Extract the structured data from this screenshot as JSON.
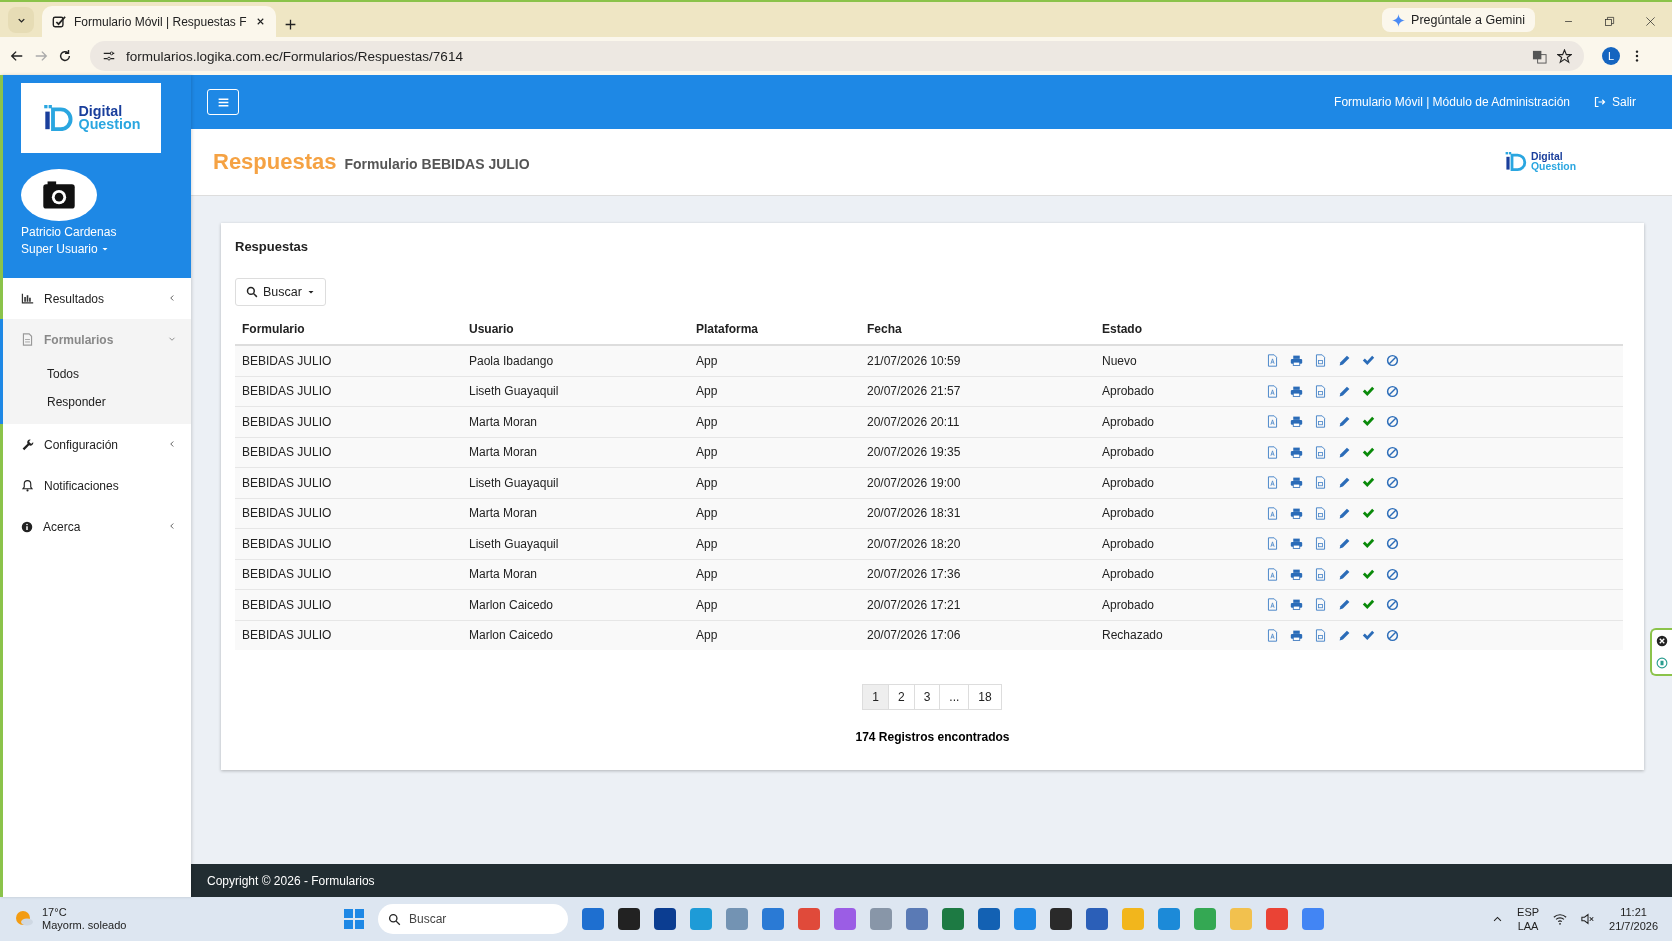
{
  "browser": {
    "tab_title": "Formulario Móvil | Respuestas F",
    "url": "formularios.logika.com.ec/Formularios/Respuestas/7614",
    "gemini": "Pregúntale a Gemini",
    "profile": "L"
  },
  "header": {
    "title": "Formulario Móvil | Módulo de Administración",
    "logout": "Salir"
  },
  "sidebar": {
    "logo": {
      "line1": "Digital",
      "line2": "Question"
    },
    "user": "Patricio Cardenas",
    "role": "Super Usuario",
    "items": [
      {
        "label": "Resultados",
        "kind": "group",
        "expanded": false,
        "selected": false
      },
      {
        "label": "Formularios",
        "kind": "group",
        "expanded": true,
        "selected": true,
        "children": [
          {
            "label": "Todos"
          },
          {
            "label": "Responder"
          }
        ]
      },
      {
        "label": "Configuración",
        "kind": "group",
        "expanded": false,
        "selected": false
      },
      {
        "label": "Notificaciones",
        "kind": "link",
        "selected": false
      },
      {
        "label": "Acerca",
        "kind": "group",
        "expanded": false,
        "selected": false
      }
    ]
  },
  "page": {
    "title": "Respuestas",
    "subtitle": "Formulario BEBIDAS JULIO",
    "logo": {
      "line1": "Digital",
      "line2": "Question"
    }
  },
  "card": {
    "title": "Respuestas",
    "search_button": "Buscar",
    "table": {
      "columns": [
        "Formulario",
        "Usuario",
        "Plataforma",
        "Fecha",
        "Estado"
      ],
      "rows": [
        {
          "cells": [
            "BEBIDAS JULIO",
            "Paola Ibadango",
            "App",
            "21/07/2026 10:59",
            "Nuevo"
          ],
          "approved": false
        },
        {
          "cells": [
            "BEBIDAS JULIO",
            "Liseth Guayaquil",
            "App",
            "20/07/2026 21:57",
            "Aprobado"
          ],
          "approved": true
        },
        {
          "cells": [
            "BEBIDAS JULIO",
            "Marta Moran",
            "App",
            "20/07/2026 20:11",
            "Aprobado"
          ],
          "approved": true
        },
        {
          "cells": [
            "BEBIDAS JULIO",
            "Marta Moran",
            "App",
            "20/07/2026 19:35",
            "Aprobado"
          ],
          "approved": true
        },
        {
          "cells": [
            "BEBIDAS JULIO",
            "Liseth Guayaquil",
            "App",
            "20/07/2026 19:00",
            "Aprobado"
          ],
          "approved": true
        },
        {
          "cells": [
            "BEBIDAS JULIO",
            "Marta Moran",
            "App",
            "20/07/2026 18:31",
            "Aprobado"
          ],
          "approved": true
        },
        {
          "cells": [
            "BEBIDAS JULIO",
            "Liseth Guayaquil",
            "App",
            "20/07/2026 18:20",
            "Aprobado"
          ],
          "approved": true
        },
        {
          "cells": [
            "BEBIDAS JULIO",
            "Marta Moran",
            "App",
            "20/07/2026 17:36",
            "Aprobado"
          ],
          "approved": true
        },
        {
          "cells": [
            "BEBIDAS JULIO",
            "Marlon Caicedo",
            "App",
            "20/07/2026 17:21",
            "Aprobado"
          ],
          "approved": true
        },
        {
          "cells": [
            "BEBIDAS JULIO",
            "Marlon Caicedo",
            "App",
            "20/07/2026 17:06",
            "Rechazado"
          ],
          "approved": false
        }
      ]
    },
    "pagination": [
      {
        "label": "1",
        "selected": true
      },
      {
        "label": "2",
        "selected": false
      },
      {
        "label": "3",
        "selected": false
      },
      {
        "label": "...",
        "selected": false
      },
      {
        "label": "18",
        "selected": false
      }
    ],
    "count": "174 Registros encontrados"
  },
  "footer": "Copyright © 2026 - Formularios",
  "taskbar": {
    "temperature": "17°C",
    "weather": "Mayorm. soleado",
    "search_placeholder": "Buscar",
    "lang1": "ESP",
    "lang2": "LAA",
    "time": "11:21",
    "date": "21/7/2026"
  }
}
